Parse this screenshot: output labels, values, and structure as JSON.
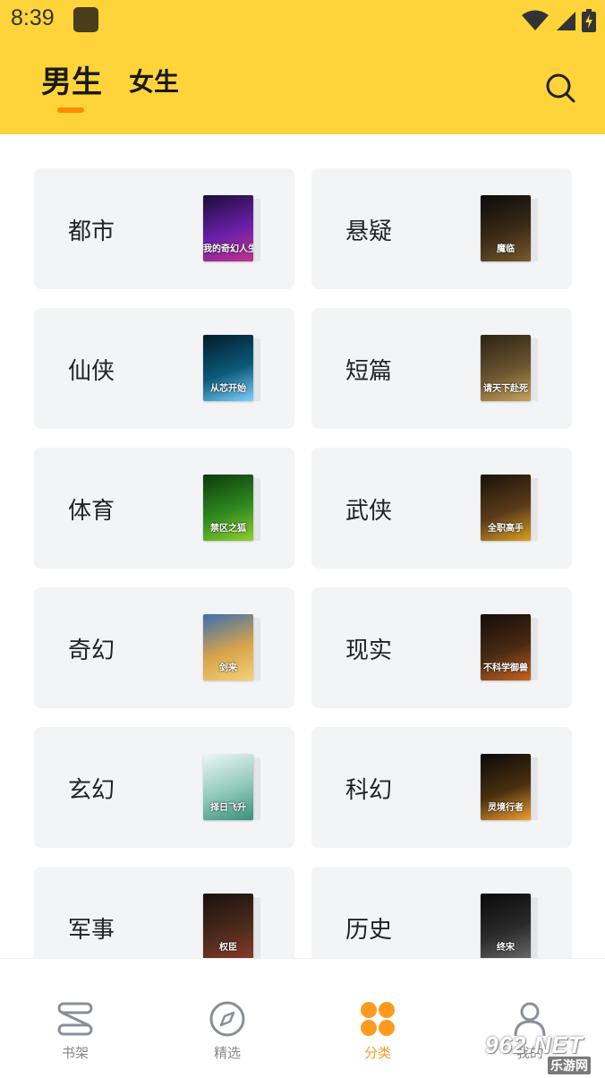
{
  "status_bar": {
    "time": "8:39",
    "icons": [
      "app-notification-icon",
      "wifi-icon",
      "signal-icon",
      "battery-charging-icon"
    ]
  },
  "header": {
    "tabs": [
      {
        "label": "男生",
        "active": true
      },
      {
        "label": "女生",
        "active": false
      }
    ],
    "search_icon": "search-icon",
    "accent_color": "#FFD43B",
    "indicator_color": "#FF8A00"
  },
  "categories": [
    {
      "label": "都市",
      "cover_text": "我的奇幻人生",
      "cover_colors": [
        "#1b0d3a",
        "#6a1fa8",
        "#c2338f"
      ]
    },
    {
      "label": "悬疑",
      "cover_text": "魔临",
      "cover_colors": [
        "#0b0b0b",
        "#3a2a16",
        "#7a5a2a"
      ]
    },
    {
      "label": "仙侠",
      "cover_text": "从芯开始",
      "cover_colors": [
        "#031a2a",
        "#0b5a7a",
        "#7fd1ff"
      ]
    },
    {
      "label": "短篇",
      "cover_text": "请天下赴死",
      "cover_colors": [
        "#2b2212",
        "#6b5430",
        "#c9a15b"
      ]
    },
    {
      "label": "体育",
      "cover_text": "禁区之狐",
      "cover_colors": [
        "#0c3a0c",
        "#2f8a1f",
        "#8fd12f"
      ]
    },
    {
      "label": "武侠",
      "cover_text": "全职高手",
      "cover_colors": [
        "#1a1208",
        "#5a3a1a",
        "#d9a020"
      ]
    },
    {
      "label": "奇幻",
      "cover_text": "剑来",
      "cover_colors": [
        "#3a6fb0",
        "#d9a44a",
        "#f3d27a"
      ]
    },
    {
      "label": "现实",
      "cover_text": "不科学御兽",
      "cover_colors": [
        "#140d08",
        "#4a2a14",
        "#c8641e"
      ]
    },
    {
      "label": "玄幻",
      "cover_text": "择日飞升",
      "cover_colors": [
        "#eef6f4",
        "#8fc9b8",
        "#3a8f7a"
      ]
    },
    {
      "label": "科幻",
      "cover_text": "灵境行者",
      "cover_colors": [
        "#0a0a0a",
        "#4a2f0f",
        "#f0a030"
      ]
    },
    {
      "label": "军事",
      "cover_text": "权臣",
      "cover_colors": [
        "#1a1010",
        "#4a2a1a",
        "#8a3a2a"
      ]
    },
    {
      "label": "历史",
      "cover_text": "终宋",
      "cover_colors": [
        "#0a0a0a",
        "#2a2a2a",
        "#6a6a6a"
      ]
    }
  ],
  "bottom_nav": [
    {
      "label": "书架",
      "icon": "bookshelf-icon",
      "active": false
    },
    {
      "label": "精选",
      "icon": "compass-icon",
      "active": false
    },
    {
      "label": "分类",
      "icon": "category-grid-icon",
      "active": true
    },
    {
      "label": "我的",
      "icon": "profile-icon",
      "active": false
    }
  ],
  "watermark": {
    "main": "962.NET",
    "sub": "乐游网"
  }
}
